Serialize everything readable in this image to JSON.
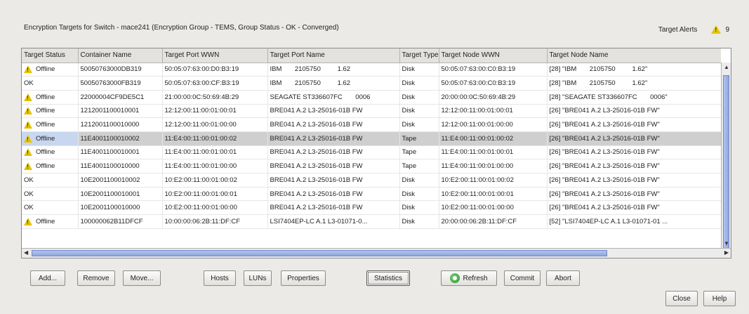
{
  "header": {
    "title": "Encryption Targets for Switch - mace241 (Encryption Group - TEMS, Group Status - OK - Converged)",
    "alerts_label": "Target Alerts",
    "alerts_count": "9"
  },
  "table": {
    "columns": [
      "Target Status",
      "Container Name",
      "Target Port WWN",
      "Target Port Name",
      "Target Type",
      "Target Node WWN",
      "Target Node Name"
    ],
    "rows": [
      {
        "warn": true,
        "status": "Offline",
        "container": "50050763000DB319",
        "port_wwn": "50:05:07:63:00:D0:B3:19",
        "port_name": "IBM       2105750         1.62",
        "type": "Disk",
        "node_wwn": "50:05:07:63:00:C0:B3:19",
        "node_name": "[28] \"IBM       2105750         1.62\""
      },
      {
        "warn": false,
        "status": "OK",
        "container": "50050763000FB319",
        "port_wwn": "50:05:07:63:00:CF:B3:19",
        "port_name": "IBM       2105750         1.62",
        "type": "Disk",
        "node_wwn": "50:05:07:63:00:C0:B3:19",
        "node_name": "[28] \"IBM       2105750         1.62\""
      },
      {
        "warn": true,
        "status": "Offline",
        "container": "22000004CF9DE5C1",
        "port_wwn": "21:00:00:0C:50:69:4B:29",
        "port_name": "SEAGATE ST336607FC       0006",
        "type": "Disk",
        "node_wwn": "20:00:00:0C:50:69:4B:29",
        "node_name": "[28] \"SEAGATE ST336607FC       0006\""
      },
      {
        "warn": true,
        "status": "Offline",
        "container": "1212001100010001",
        "port_wwn": "12:12:00:11:00:01:00:01",
        "port_name": "BRE041 A.2 L3-25016-01B FW",
        "type": "Disk",
        "node_wwn": "12:12:00:11:00:01:00:01",
        "node_name": "[26] \"BRE041 A.2 L3-25016-01B FW\""
      },
      {
        "warn": true,
        "status": "Offline",
        "container": "1212001100010000",
        "port_wwn": "12:12:00:11:00:01:00:00",
        "port_name": "BRE041 A.2 L3-25016-01B FW",
        "type": "Disk",
        "node_wwn": "12:12:00:11:00:01:00:00",
        "node_name": "[26] \"BRE041 A.2 L3-25016-01B FW\""
      },
      {
        "warn": true,
        "status": "Offline",
        "container": "11E4001100010002",
        "port_wwn": "11:E4:00:11:00:01:00:02",
        "port_name": "BRE041 A.2 L3-25016-01B FW",
        "type": "Tape",
        "node_wwn": "11:E4:00:11:00:01:00:02",
        "node_name": "[26] \"BRE041 A.2 L3-25016-01B FW\"",
        "selected": true
      },
      {
        "warn": true,
        "status": "Offline",
        "container": "11E4001100010001",
        "port_wwn": "11:E4:00:11:00:01:00:01",
        "port_name": "BRE041 A.2 L3-25016-01B FW",
        "type": "Tape",
        "node_wwn": "11:E4:00:11:00:01:00:01",
        "node_name": "[26] \"BRE041 A.2 L3-25016-01B FW\""
      },
      {
        "warn": true,
        "status": "Offline",
        "container": "11E4001100010000",
        "port_wwn": "11:E4:00:11:00:01:00:00",
        "port_name": "BRE041 A.2 L3-25016-01B FW",
        "type": "Tape",
        "node_wwn": "11:E4:00:11:00:01:00:00",
        "node_name": "[26] \"BRE041 A.2 L3-25016-01B FW\""
      },
      {
        "warn": false,
        "status": "OK",
        "container": "10E2001100010002",
        "port_wwn": "10:E2:00:11:00:01:00:02",
        "port_name": "BRE041 A.2 L3-25016-01B FW",
        "type": "Disk",
        "node_wwn": "10:E2:00:11:00:01:00:02",
        "node_name": "[26] \"BRE041 A.2 L3-25016-01B FW\""
      },
      {
        "warn": false,
        "status": "OK",
        "container": "10E2001100010001",
        "port_wwn": "10:E2:00:11:00:01:00:01",
        "port_name": "BRE041 A.2 L3-25016-01B FW",
        "type": "Disk",
        "node_wwn": "10:E2:00:11:00:01:00:01",
        "node_name": "[26] \"BRE041 A.2 L3-25016-01B FW\""
      },
      {
        "warn": false,
        "status": "OK",
        "container": "10E2001100010000",
        "port_wwn": "10:E2:00:11:00:01:00:00",
        "port_name": "BRE041 A.2 L3-25016-01B FW",
        "type": "Disk",
        "node_wwn": "10:E2:00:11:00:01:00:00",
        "node_name": "[26] \"BRE041 A.2 L3-25016-01B FW\""
      },
      {
        "warn": true,
        "status": "Offline",
        "container": "100000062B11DFCF",
        "port_wwn": "10:00:00:06:2B:11:DF:CF",
        "port_name": "LSI7404EP-LC A.1 L3-01071-0...",
        "type": "Disk",
        "node_wwn": "20:00:00:06:2B:11:DF:CF",
        "node_name": "[52] \"LSI7404EP-LC A.1 L3-01071-01 ..."
      }
    ]
  },
  "buttons": {
    "add": "Add...",
    "remove": "Remove",
    "move": "Move...",
    "hosts": "Hosts",
    "luns": "LUNs",
    "properties": "Properties",
    "statistics": "Statistics",
    "refresh": "Refresh",
    "commit": "Commit",
    "abort": "Abort",
    "close": "Close",
    "help": "Help"
  },
  "colors": {
    "warning": "#e5c400",
    "scroll_thumb": "#9db0e6",
    "selected_row": "#cfcfcf"
  }
}
